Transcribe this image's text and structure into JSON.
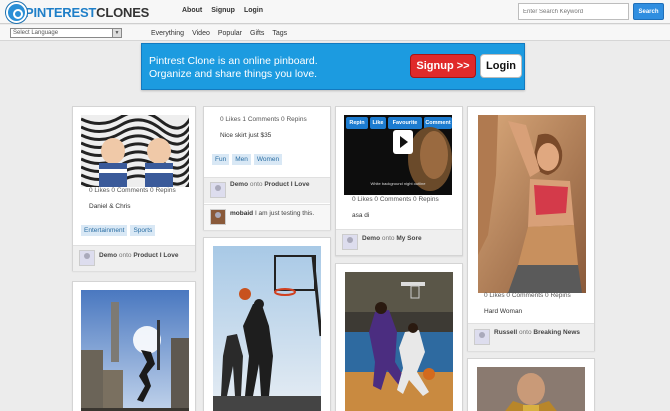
{
  "header": {
    "logo_part1": "PIN",
    "logo_part2": "TEREST",
    "logo_part3": "CLONES",
    "nav": [
      "About",
      "Signup",
      "Login"
    ],
    "search_placeholder": "Enter Search Keyword",
    "search_button": "Search"
  },
  "subbar": {
    "language": "Select Language",
    "categories": [
      "Everything",
      "Video",
      "Popular",
      "Gifts",
      "Tags"
    ]
  },
  "banner": {
    "line1": "Pintrest Clone is an online pinboard.",
    "line2": "Organize and share things you love.",
    "signup": "Signup >>",
    "login": "Login"
  },
  "pins": {
    "p1": {
      "stats": "0 Likes 0 Comments 0 Repins",
      "desc": "Daniel & Chris",
      "tags": [
        "Entertainment",
        "Sports"
      ],
      "user": "Demo",
      "onto": "onto",
      "board": "Product I Love"
    },
    "p2": {
      "stats": "0 Likes 1 Comments 0 Repins",
      "desc": "Nice skirt just $35",
      "tags": [
        "Fun",
        "Men",
        "Women"
      ],
      "user": "Demo",
      "onto": "onto",
      "board": "Product I Love",
      "comment_user": "mobaid",
      "comment_text": "I am just testing this."
    },
    "p3": {
      "buttons": [
        "Repin",
        "Like",
        "Favourite",
        "Comment"
      ],
      "video_caption": "White background night outline",
      "stats": "0 Likes 0 Comments 0 Repins",
      "desc": "asa di",
      "user": "Demo",
      "onto": "onto",
      "board": "My Sore"
    },
    "p4": {
      "stats": "0 Likes 0 Comments 0 Repins",
      "desc": "Hard Woman",
      "user": "Russell",
      "onto": "onto",
      "board": "Breaking News"
    }
  }
}
